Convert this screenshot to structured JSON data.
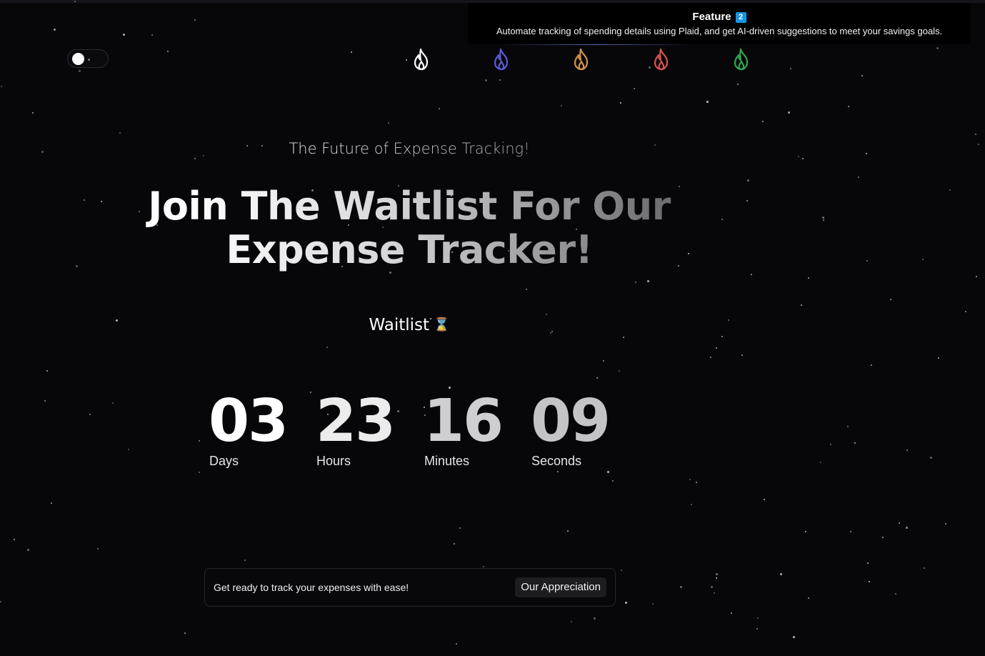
{
  "toggle": {
    "state": "off"
  },
  "flames": [
    {
      "icon": "flame-icon",
      "color": "#ffffff"
    },
    {
      "icon": "flame-icon",
      "color": "#5b5bd6"
    },
    {
      "icon": "flame-icon",
      "color": "#d4924a"
    },
    {
      "icon": "flame-icon",
      "color": "#d9534f"
    },
    {
      "icon": "flame-icon",
      "color": "#2ea84e"
    }
  ],
  "toast": {
    "title": "Feature",
    "badge": "2",
    "message": "Automate tracking of spending details using Plaid, and get AI-driven suggestions to meet your savings goals."
  },
  "hero": {
    "subtitle": "The Future of Expense Tracking!",
    "headline_line1": "Join The Waitlist For Our",
    "headline_line2": "Expense Tracker!",
    "waitlist_label": "Waitlist",
    "waitlist_icon": "⌛"
  },
  "countdown": {
    "days": {
      "value": "03",
      "label": "Days"
    },
    "hours": {
      "value": "23",
      "label": "Hours"
    },
    "minutes": {
      "value": "16",
      "label": "Minutes"
    },
    "seconds": {
      "value": "09",
      "label": "Seconds"
    }
  },
  "cta": {
    "text": "Get ready to track your expenses with ease!",
    "button_label": "Our Appreciation"
  },
  "colors": {
    "background": "#07070a",
    "badge": "#1296e5",
    "digits_days": "#ffffff",
    "digits_hours": "#ececec",
    "digits_minutes": "#cfcfd2",
    "digits_seconds": "#c4c4c7"
  }
}
